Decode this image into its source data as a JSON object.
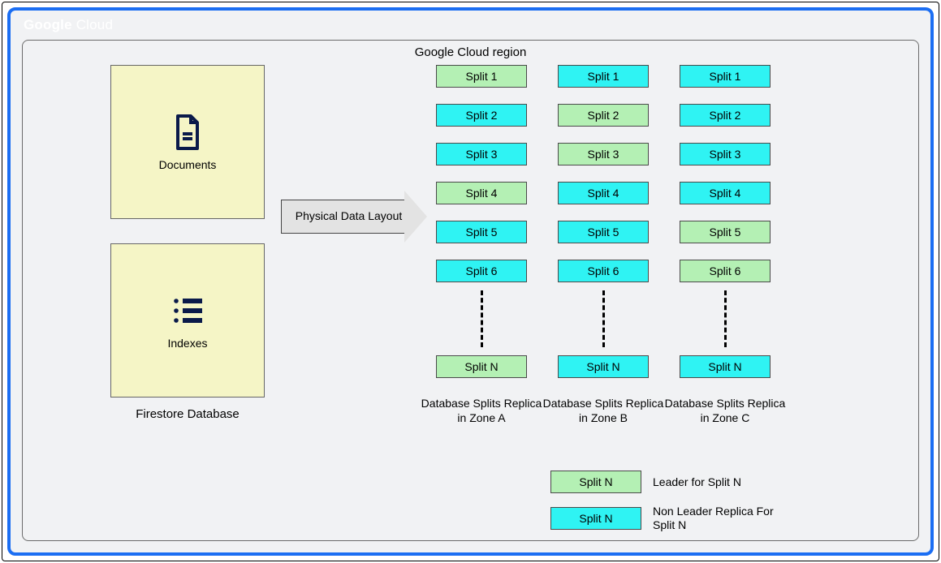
{
  "header": {
    "brand_bold": "Google",
    "brand_rest": " Cloud"
  },
  "region_title": "Google Cloud region",
  "left": {
    "documents_label": "Documents",
    "indexes_label": "Indexes",
    "db_caption": "Firestore Database"
  },
  "arrow": {
    "label": "Physical Data Layout"
  },
  "columns": {
    "A": {
      "caption": "Database Splits Replica in Zone A",
      "splits": [
        {
          "label": "Split 1",
          "role": "leader"
        },
        {
          "label": "Split 2",
          "role": "replica"
        },
        {
          "label": "Split 3",
          "role": "replica"
        },
        {
          "label": "Split 4",
          "role": "leader"
        },
        {
          "label": "Split 5",
          "role": "replica"
        },
        {
          "label": "Split 6",
          "role": "replica"
        },
        {
          "label": "Split N",
          "role": "leader"
        }
      ]
    },
    "B": {
      "caption": "Database Splits Replica in Zone B",
      "splits": [
        {
          "label": "Split 1",
          "role": "replica"
        },
        {
          "label": "Split 2",
          "role": "leader"
        },
        {
          "label": "Split 3",
          "role": "leader"
        },
        {
          "label": "Split 4",
          "role": "replica"
        },
        {
          "label": "Split 5",
          "role": "replica"
        },
        {
          "label": "Split 6",
          "role": "replica"
        },
        {
          "label": "Split N",
          "role": "replica"
        }
      ]
    },
    "C": {
      "caption": "Database Splits Replica in Zone C",
      "splits": [
        {
          "label": "Split 1",
          "role": "replica"
        },
        {
          "label": "Split 2",
          "role": "replica"
        },
        {
          "label": "Split 3",
          "role": "replica"
        },
        {
          "label": "Split 4",
          "role": "replica"
        },
        {
          "label": "Split 5",
          "role": "leader"
        },
        {
          "label": "Split 6",
          "role": "leader"
        },
        {
          "label": "Split N",
          "role": "replica"
        }
      ]
    }
  },
  "legend": {
    "leader": {
      "swatch_label": "Split N",
      "text": "Leader for Split N"
    },
    "replica": {
      "swatch_label": "Split N",
      "text": "Non Leader Replica For Split N"
    }
  },
  "colors": {
    "leader": "#b4f0b4",
    "replica": "#2ff3f3",
    "frame": "#1b6ef3",
    "panel": "#f1f2f4",
    "note": "#f5f5c6"
  }
}
